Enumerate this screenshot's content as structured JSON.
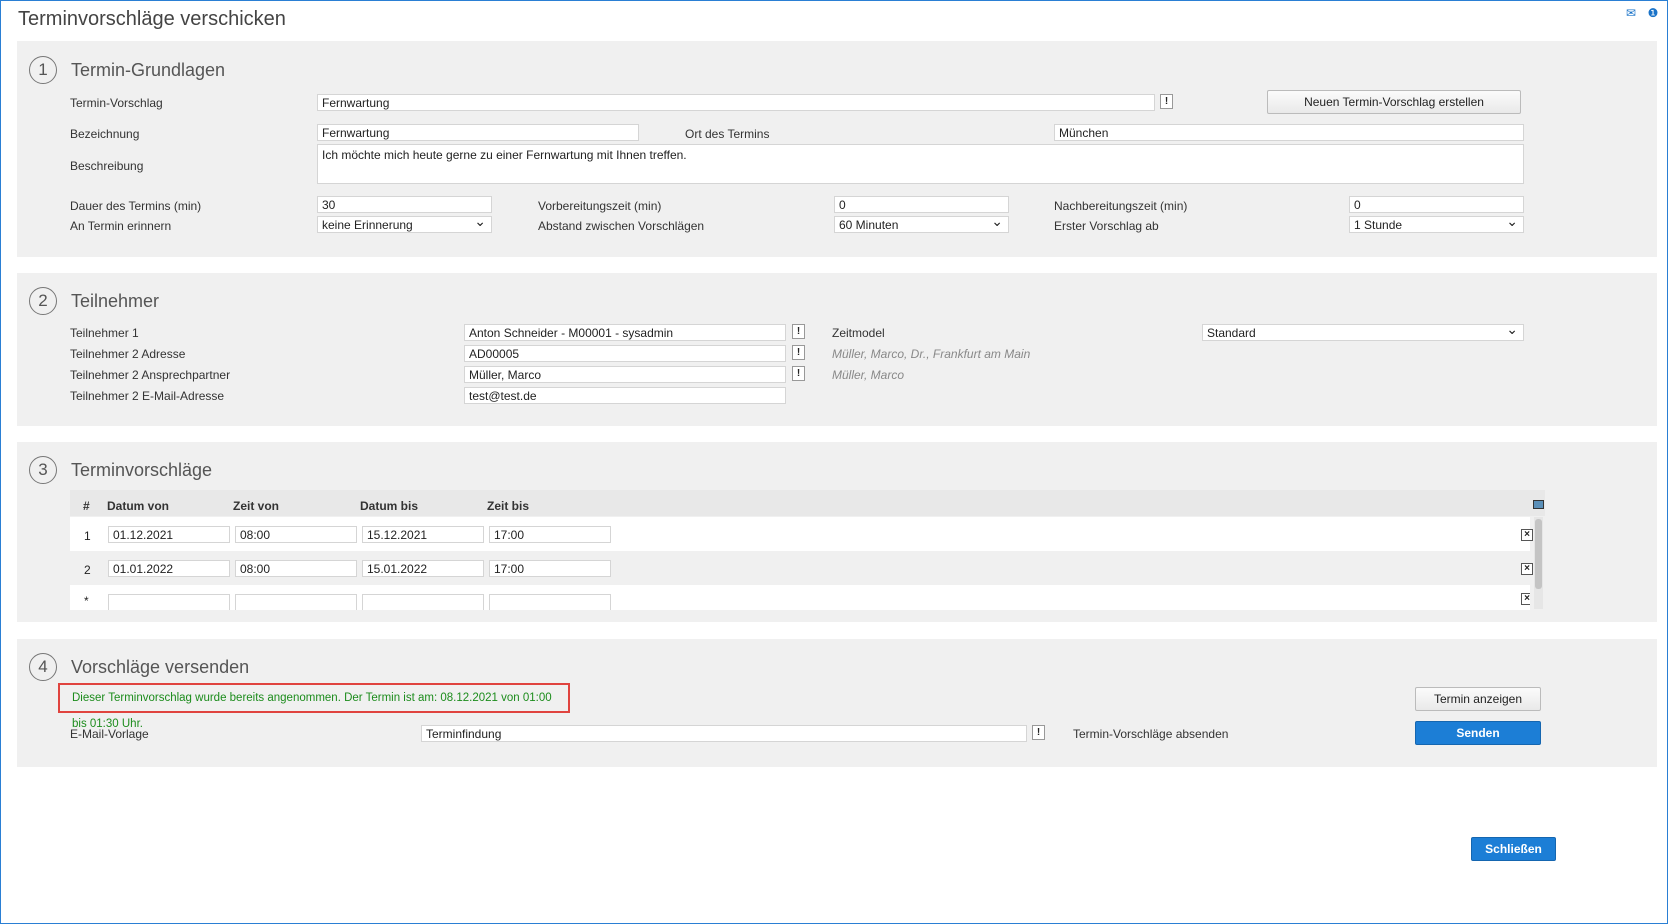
{
  "window": {
    "title": "Terminvorschläge verschicken",
    "icons": [
      "mail-icon",
      "help-icon"
    ]
  },
  "section1": {
    "number": "1",
    "title": "Termin-Grundlagen",
    "termin_vorschlag_label": "Termin-Vorschlag",
    "termin_vorschlag_value": "Fernwartung",
    "new_button": "Neuen Termin-Vorschlag erstellen",
    "bezeichnung_label": "Bezeichnung",
    "bezeichnung_value": "Fernwartung",
    "ort_label": "Ort des Termins",
    "ort_value": "München",
    "beschreibung_label": "Beschreibung",
    "beschreibung_value": "Ich möchte mich heute gerne zu einer Fernwartung mit Ihnen treffen.",
    "dauer_label": "Dauer des Termins (min)",
    "dauer_value": "30",
    "vorbereitung_label": "Vorbereitungszeit (min)",
    "vorbereitung_value": "0",
    "nachbereitung_label": "Nachbereitungszeit (min)",
    "nachbereitung_value": "0",
    "erinnern_label": "An Termin erinnern",
    "erinnern_value": "keine Erinnerung",
    "abstand_label": "Abstand zwischen Vorschlägen",
    "abstand_value": "60 Minuten",
    "erster_label": "Erster Vorschlag ab",
    "erster_value": "1 Stunde"
  },
  "section2": {
    "number": "2",
    "title": "Teilnehmer",
    "t1_label": "Teilnehmer 1",
    "t1_value": "Anton Schneider - M00001 - sysadmin",
    "t2_adr_label": "Teilnehmer 2 Adresse",
    "t2_adr_value": "AD00005",
    "t2_adr_hint": "Müller, Marco, Dr., Frankfurt am Main",
    "t2_ans_label": "Teilnehmer 2 Ansprechpartner",
    "t2_ans_value": "Müller, Marco",
    "t2_ans_hint": "Müller, Marco",
    "t2_mail_label": "Teilnehmer 2 E-Mail-Adresse",
    "t2_mail_value": "test@test.de",
    "zeitmodel_label": "Zeitmodel",
    "zeitmodel_value": "Standard"
  },
  "section3": {
    "number": "3",
    "title": "Terminvorschläge",
    "columns": [
      "#",
      "Datum von",
      "Zeit von",
      "Datum bis",
      "Zeit bis"
    ],
    "rows": [
      {
        "num": "1",
        "datum_von": "01.12.2021",
        "zeit_von": "08:00",
        "datum_bis": "15.12.2021",
        "zeit_bis": "17:00"
      },
      {
        "num": "2",
        "datum_von": "01.01.2022",
        "zeit_von": "08:00",
        "datum_bis": "15.01.2022",
        "zeit_bis": "17:00"
      },
      {
        "num": "*",
        "datum_von": "",
        "zeit_von": "",
        "datum_bis": "",
        "zeit_bis": ""
      }
    ]
  },
  "section4": {
    "number": "4",
    "title": "Vorschläge versenden",
    "notice": "Dieser Terminvorschlag wurde bereits angenommen. Der Termin ist am: 08.12.2021 von 01:00 bis 01:30 Uhr.",
    "show_button": "Termin anzeigen",
    "vorlage_label": "E-Mail-Vorlage",
    "vorlage_value": "Terminfindung",
    "absenden_label": "Termin-Vorschläge absenden",
    "send_button": "Senden"
  },
  "footer": {
    "close_button": "Schließen"
  },
  "colors": {
    "accent": "#1c7ed6",
    "notice_text": "#1c8c1c",
    "notice_border": "#e0443f"
  }
}
